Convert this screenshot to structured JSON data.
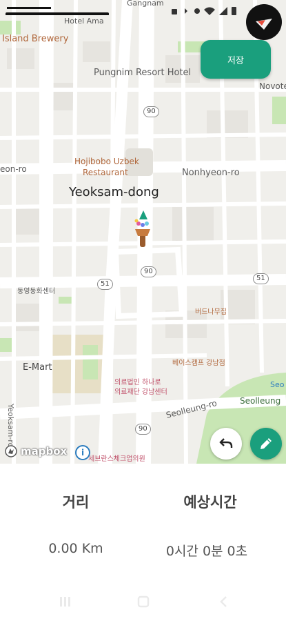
{
  "status_bar": {
    "time": "",
    "icons": [
      "notification-icon",
      "bluetooth-icon",
      "location-icon",
      "wifi-icon",
      "signal-icon",
      "battery-icon"
    ]
  },
  "map": {
    "labels": {
      "gangnam": "Gangnam",
      "hotel_top": "Hotel Ama",
      "island_brewery": "Island Brewery",
      "pungnim": "Pungnim Resort Hotel",
      "novotel": "Novote",
      "hojibobo_1": "Hojibobo Uzbek",
      "hojibobo_2": "Restaurant",
      "eon_ro": "eon-ro",
      "nonhyeon_ro": "Nonhyeon-ro",
      "yeoksam_dong": "Yeoksam-dong",
      "kr_left": "동영동화센터",
      "kr_food1": "버드나무집",
      "emart": "E-Mart",
      "kr_food2": "베이스캠프 강남점",
      "kr_clinic_1": "의료법인 하나로",
      "kr_clinic_2": "의료재단 강남센터",
      "yeoksam_ro": "Yeoksam-ro",
      "seolleung_ro": "Seolleung-ro",
      "seolleung": "Seolleung",
      "seo": "Seo",
      "kr_bottom": "세브란스체크업의원"
    },
    "shields": {
      "r90_top": "90",
      "r90_mid": "90",
      "r90_bot": "90",
      "r51_left": "51",
      "r51_right": "51"
    },
    "attribution": "mapbox"
  },
  "buttons": {
    "save": "저장"
  },
  "stats": {
    "distance_label": "거리",
    "distance_value": "0.00 Km",
    "time_label": "예상시간",
    "time_value": "0시간 0분 0초"
  },
  "colors": {
    "accent": "#1a9f7d",
    "park": "#c8e6b4",
    "road": "#ffffff"
  }
}
